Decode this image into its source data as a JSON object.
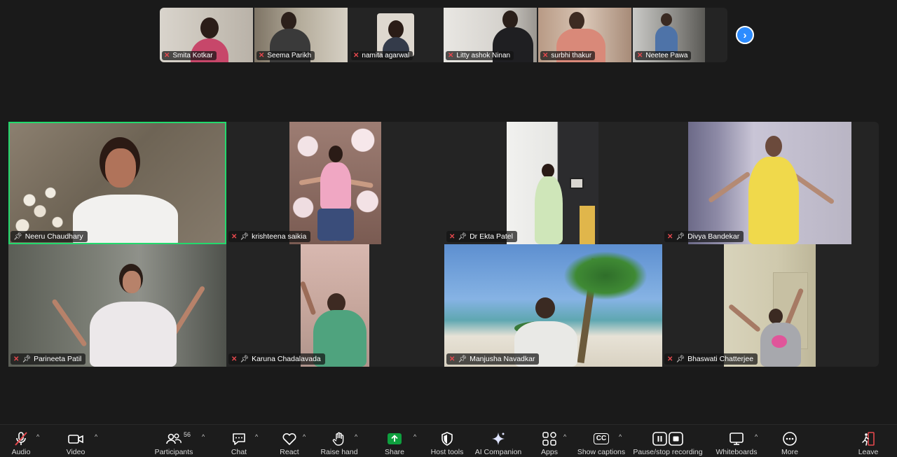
{
  "top_strip": {
    "participants": [
      {
        "name": "Smita Kotkar",
        "muted": true
      },
      {
        "name": "Seema Parikh",
        "muted": true
      },
      {
        "name": "namita agarwal",
        "muted": true
      },
      {
        "name": "Litty ashok Ninan",
        "muted": true
      },
      {
        "name": "surbhi thakur",
        "muted": true
      },
      {
        "name": "Neetee Pawa",
        "muted": true
      }
    ],
    "next_icon": "chevron-right-icon"
  },
  "gallery": {
    "tiles": [
      {
        "name": "Neeru Chaudhary",
        "pinned": true,
        "muted": false,
        "active_speaker": true
      },
      {
        "name": "krishteena saikia",
        "pinned": true,
        "muted": true
      },
      {
        "name": "Dr Ekta Patel",
        "pinned": true,
        "muted": true
      },
      {
        "name": "Divya Bandekar",
        "pinned": true,
        "muted": true
      },
      {
        "name": "Parineeta Patil",
        "pinned": true,
        "muted": true
      },
      {
        "name": "Karuna Chadalavada",
        "pinned": true,
        "muted": true
      },
      {
        "name": "Manjusha Navadkar",
        "pinned": true,
        "muted": true
      },
      {
        "name": "Bhaswati Chatterjee",
        "pinned": true,
        "muted": true
      }
    ]
  },
  "toolbar": {
    "audio": "Audio",
    "video": "Video",
    "participants": "Participants",
    "participants_count": "56",
    "chat": "Chat",
    "react": "React",
    "raise_hand": "Raise hand",
    "share": "Share",
    "host_tools": "Host tools",
    "ai_companion": "AI Companion",
    "apps": "Apps",
    "show_captions": "Show captions",
    "captions_icon_text": "CC",
    "recording": "Pause/stop recording",
    "whiteboards": "Whiteboards",
    "more": "More",
    "leave": "Leave"
  },
  "colors": {
    "accent_green": "#23d96d",
    "share_green": "#0e9f3e",
    "muted_red": "#e5484d",
    "link_blue": "#2d8cff"
  }
}
